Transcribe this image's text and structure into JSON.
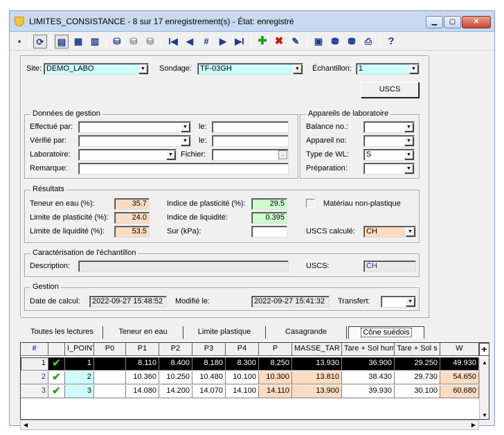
{
  "window": {
    "title": "LIMITES_CONSISTANCE - 8 sur 17 enregistrement(s) - État: enregistré"
  },
  "toolbar": {
    "icons": [
      "save-icon",
      "refresh-icon",
      "form-view-icon",
      "table-view-icon",
      "list-view-icon",
      "db-icon",
      "db-copy-icon",
      "db-delete-icon",
      "first-icon",
      "prev-icon",
      "goto-icon",
      "next-icon",
      "last-icon",
      "add-icon",
      "delete-icon",
      "edit-icon",
      "report-icon",
      "export-icon",
      "import-icon",
      "print-icon",
      "help-icon"
    ],
    "nav_first": "I◀",
    "nav_prev": "◀",
    "nav_goto": "#",
    "nav_next": "▶",
    "nav_last": "▶I",
    "help": "?"
  },
  "header_fields": {
    "site_label": "Site:",
    "site_value": "DEMO_LABO",
    "sondage_label": "Sondage:",
    "sondage_value": "TF-03GH",
    "echantillon_label": "Échantillon:",
    "echantillon_value": "1",
    "uscs_button": "USCS"
  },
  "gestion_donnees": {
    "title": "Données de gestion",
    "effectue_label": "Effectué par:",
    "effectue_value": "",
    "effectue_le_label": "le:",
    "effectue_le_value": "",
    "verifie_label": "Vérifié par:",
    "verifie_value": "",
    "verifie_le_label": "le:",
    "verifie_le_value": "",
    "labo_label": "Laboratoire:",
    "labo_value": "",
    "fichier_label": "Fichier:",
    "fichier_value": "",
    "remarque_label": "Remarque:",
    "remarque_value": ""
  },
  "appareils": {
    "title": "Appareils de laboratoire",
    "balance_label": "Balance no.:",
    "balance_value": "",
    "appareil_label": "Appareil no:",
    "appareil_value": "",
    "type_wl_label": "Type de WL:",
    "type_wl_value": "S",
    "preparation_label": "Préparation:",
    "preparation_value": ""
  },
  "resultats": {
    "title": "Résultats",
    "teneur_label": "Teneur en eau (%):",
    "teneur_value": "35.7",
    "lp_label": "Limite de plasticité (%):",
    "lp_value": "24.0",
    "ll_label": "Limite de liquidité (%):",
    "ll_value": "53.5",
    "ip_label": "Indice de plasticité (%):",
    "ip_value": "29.5",
    "il_label": "Indice de liquidité:",
    "il_value": "0.395",
    "sur_label": "Sur (kPa):",
    "sur_value": "",
    "non_plastique_label": "Matériau non-plastique",
    "uscs_calc_label": "USCS calculé:",
    "uscs_calc_value": "CH"
  },
  "caracterisation": {
    "title": "Caractérisation de l'échantillon",
    "description_label": "Description:",
    "description_value": "",
    "uscs_label": "USCS:",
    "uscs_value": "CH"
  },
  "gestion": {
    "title": "Gestion",
    "date_calc_label": "Date de calcul:",
    "date_calc_value": "2022-09-27 15:48:52",
    "modifie_label": "Modifié le:",
    "modifie_value": "2022-09-27 15:41:32",
    "transfert_label": "Transfert:",
    "transfert_value": ""
  },
  "tabs": [
    {
      "label": "Toutes les lectures"
    },
    {
      "label": "Teneur en eau"
    },
    {
      "label": "Limite plastique"
    },
    {
      "label": "Casagrande"
    },
    {
      "label": "Cône suédois"
    }
  ],
  "table": {
    "headers": [
      "#",
      "",
      "I_POINT",
      "P0",
      "P1",
      "P2",
      "P3",
      "P4",
      "P",
      "MASSE_TAR",
      "Tare + Sol hum",
      "Tare + Sol s",
      "W"
    ],
    "rows": [
      {
        "n": "1",
        "ipoint": "1",
        "p0": "",
        "p1": "8.110",
        "p2": "8.400",
        "p3": "8.180",
        "p4": "8.300",
        "p": "8.250",
        "masse": "13.930",
        "hum": "36.900",
        "sec": "29.250",
        "w": "49.930"
      },
      {
        "n": "2",
        "ipoint": "2",
        "p0": "",
        "p1": "10.360",
        "p2": "10.250",
        "p3": "10.480",
        "p4": "10.100",
        "p": "10.300",
        "masse": "13.810",
        "hum": "38.430",
        "sec": "29.730",
        "w": "54.650"
      },
      {
        "n": "3",
        "ipoint": "3",
        "p0": "",
        "p1": "14.080",
        "p2": "14.200",
        "p3": "14.070",
        "p4": "14.100",
        "p": "14.110",
        "masse": "13.900",
        "hum": "39.930",
        "sec": "30.100",
        "w": "60.680"
      }
    ]
  }
}
